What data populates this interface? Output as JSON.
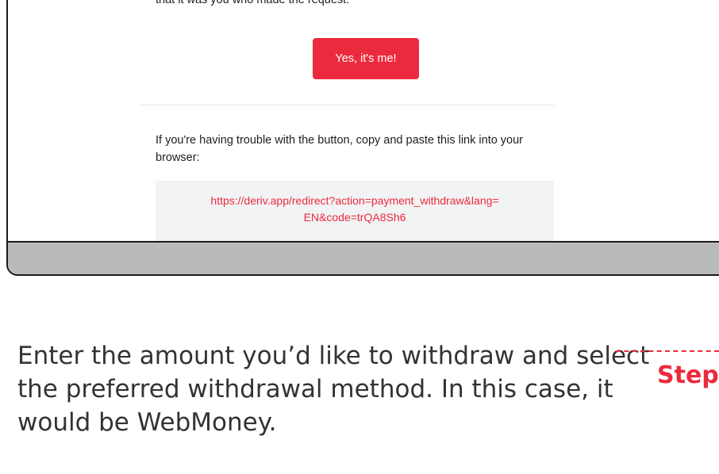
{
  "email": {
    "top_text": "that it was you who made the request.",
    "confirm_button": "Yes, it's me!",
    "trouble_text": "If you're having trouble with the button, copy and paste this link into your browser:",
    "link_line1": "https://deriv.app/redirect?action=payment_withdraw&lang=",
    "link_line2": "EN&code=trQA8Sh6"
  },
  "caption": {
    "text": "Enter the amount you’d like to withdraw and select the preferred withdrawal method. In this case, it would be WebMoney.",
    "step_label": "Step"
  },
  "colors": {
    "accent": "#ec2a3d",
    "frame_bar": "#b9babc",
    "link_box_bg": "#f2f3f4"
  }
}
